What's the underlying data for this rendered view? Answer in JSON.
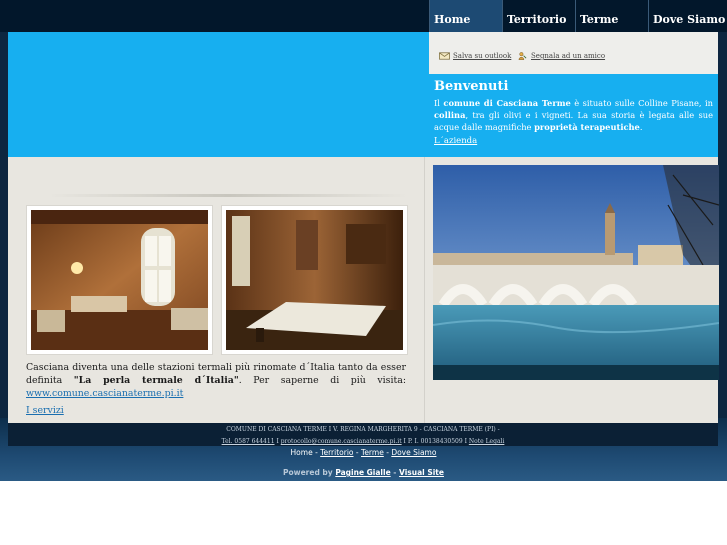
{
  "nav": {
    "items": [
      "Home",
      "Territorio",
      "Terme",
      "Dove Siamo"
    ]
  },
  "toolbar": {
    "save_outlook": "Salva su outlook",
    "tell_friend": "Segnala ad un amico"
  },
  "welcome": {
    "title": "Benvenuti",
    "text_1": "Il ",
    "text_bold_1": "comune di Casciana Terme",
    "text_2": " è situato  sulle Colline Pisane, in ",
    "text_bold_2": "collina",
    "text_3": ", tra gli olivi e i vigneti. La sua storia è legata alle sue acque dalle magnifiche ",
    "text_bold_3": "proprietà terapeutiche",
    "text_4": ".",
    "link": "L´azienda"
  },
  "content": {
    "desc_1": "Casciana diventa una delle stazioni termali più rinomate d´Italia tanto da esser definita ",
    "desc_bold": "\"La perla termale d´Italia\"",
    "desc_2": ". Per saperne di più visita: ",
    "desc_link": "www.comune.cascianaterme.pi.it",
    "services_link": "I servizi"
  },
  "footer": {
    "line1": "COMUNE DI CASCIANA TERME I V. REGINA MARGHERITA 9 - CASCIANA TERME (PI) -",
    "phone": "Tel. 0587 644411",
    "email": "protocollo@comune.cascianaterme.pi.it",
    "piva": "P. I. 00138430509",
    "legal": "Note Legali",
    "nav": [
      "Home",
      "Territorio",
      "Terme",
      "Dove Siamo"
    ],
    "nav_sep": "-",
    "powered_label": "Powered by",
    "powered_link_1": "Pagine Gialle",
    "powered_link_2": "Visual Site"
  },
  "colors": {
    "banner_blue": "#17aff0",
    "dark_navy": "#02172b",
    "content_bg": "#e8e6e0"
  }
}
